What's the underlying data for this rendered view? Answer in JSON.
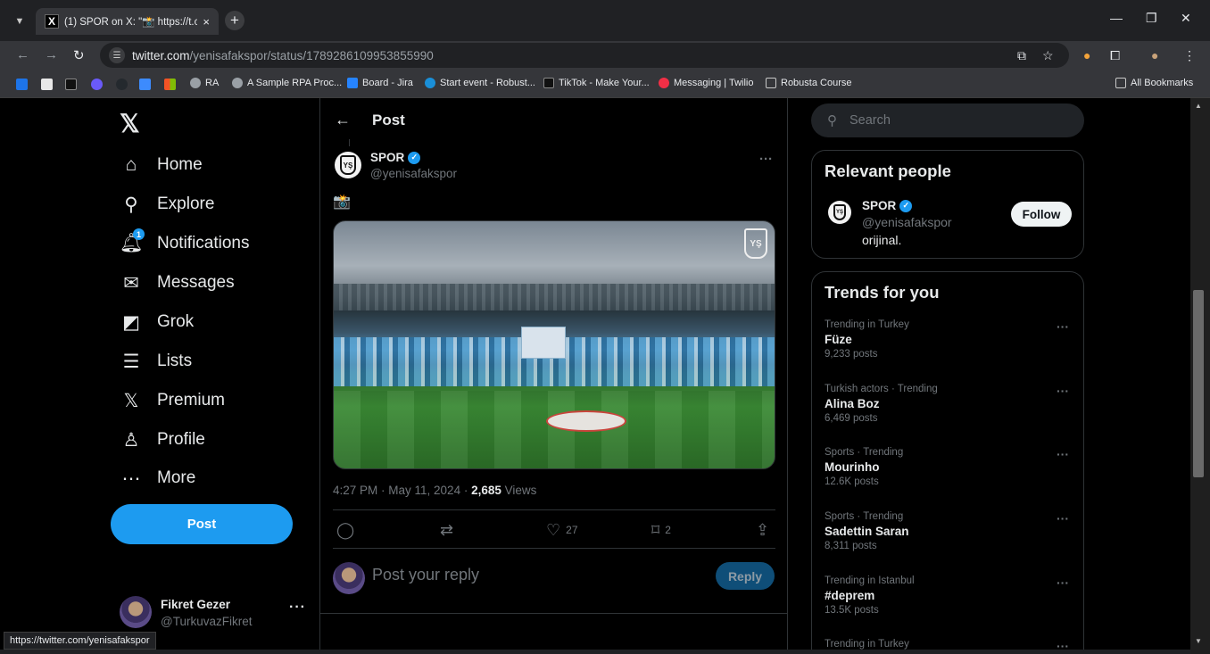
{
  "browser": {
    "tab_title": "(1) SPOR on X: \"📸 https://t.co/",
    "tab_close": "×",
    "new_tab": "+",
    "url_host": "twitter.com",
    "url_path": "/yenisafakspor/status/1789286109953855990",
    "bookmarks": [
      "RA",
      "A Sample RPA Proc...",
      "Board - Jira",
      "Start event - Robust...",
      "TikTok - Make Your...",
      "Messaging | Twilio",
      "Robusta Course"
    ],
    "all_bookmarks": "All Bookmarks",
    "status_url": "https://twitter.com/yenisafakspor"
  },
  "nav": {
    "items": [
      {
        "label": "Home",
        "icon": "⌂"
      },
      {
        "label": "Explore",
        "icon": "⚲"
      },
      {
        "label": "Notifications",
        "icon": "🔔︎",
        "badge": "1"
      },
      {
        "label": "Messages",
        "icon": "✉"
      },
      {
        "label": "Grok",
        "icon": "◩"
      },
      {
        "label": "Lists",
        "icon": "☰"
      },
      {
        "label": "Premium",
        "icon": "𝕏"
      },
      {
        "label": "Profile",
        "icon": "♙"
      },
      {
        "label": "More",
        "icon": "⋯"
      }
    ],
    "post_button": "Post",
    "account": {
      "name": "Fikret Gezer",
      "handle": "@TurkuvazFikret"
    }
  },
  "post": {
    "header": "Post",
    "author_name": "SPOR",
    "author_handle": "@yenisafakspor",
    "text": "📸",
    "meta_time": "4:27 PM · May 11, 2024 · ",
    "views_count": "2,685",
    "views_label": " Views",
    "likes": "27",
    "bookmarks": "2",
    "reply_placeholder": "Post your reply",
    "reply_button": "Reply"
  },
  "sidebar": {
    "search_placeholder": "Search",
    "relevant_title": "Relevant people",
    "relevant": {
      "name": "SPOR",
      "handle": "@yenisafakspor",
      "bio": "orijinal.",
      "follow": "Follow"
    },
    "trends_title": "Trends for you",
    "trends": [
      {
        "context": "Trending in Turkey",
        "name": "Füze",
        "count": "9,233 posts"
      },
      {
        "context": "Turkish actors · Trending",
        "name": "Alina Boz",
        "count": "6,469 posts"
      },
      {
        "context": "Sports · Trending",
        "name": "Mourinho",
        "count": "12.6K posts"
      },
      {
        "context": "Sports · Trending",
        "name": "Sadettin Saran",
        "count": "8,311 posts"
      },
      {
        "context": "Trending in Istanbul",
        "name": "#deprem",
        "count": "13.5K posts"
      },
      {
        "context": "Trending in Turkey",
        "name": "",
        "count": ""
      }
    ]
  },
  "colors": {
    "accent": "#1d9bf0",
    "background": "#000000",
    "border": "#2f3336",
    "muted": "#71767b"
  }
}
